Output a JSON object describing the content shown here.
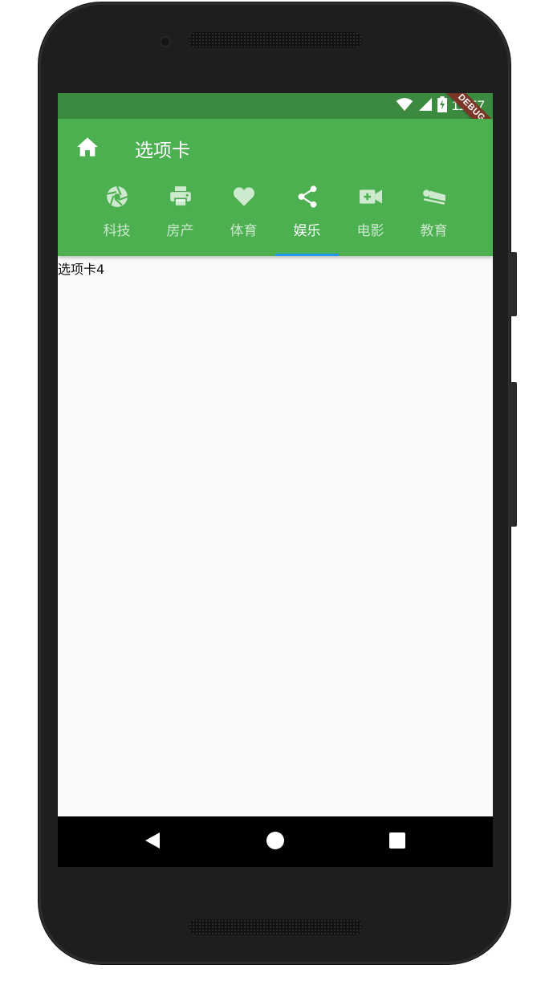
{
  "status_bar": {
    "time": "11:57"
  },
  "app_bar": {
    "title": "选项卡"
  },
  "tabs": [
    {
      "label": "科技",
      "icon": "camera-aperture-icon",
      "active": false
    },
    {
      "label": "房产",
      "icon": "printer-icon",
      "active": false
    },
    {
      "label": "体育",
      "icon": "heart-icon",
      "active": false
    },
    {
      "label": "娱乐",
      "icon": "share-icon",
      "active": true
    },
    {
      "label": "电影",
      "icon": "video-call-icon",
      "active": false
    },
    {
      "label": "教育",
      "icon": "airline-seat-icon",
      "active": false
    }
  ],
  "content": {
    "text": "选项卡4"
  },
  "debug_banner": "DEBUG",
  "colors": {
    "app_bar": "#4caf50",
    "status_bar": "#3c8a40",
    "tab_indicator": "#2196f3",
    "debug_banner": "#7a3527"
  }
}
